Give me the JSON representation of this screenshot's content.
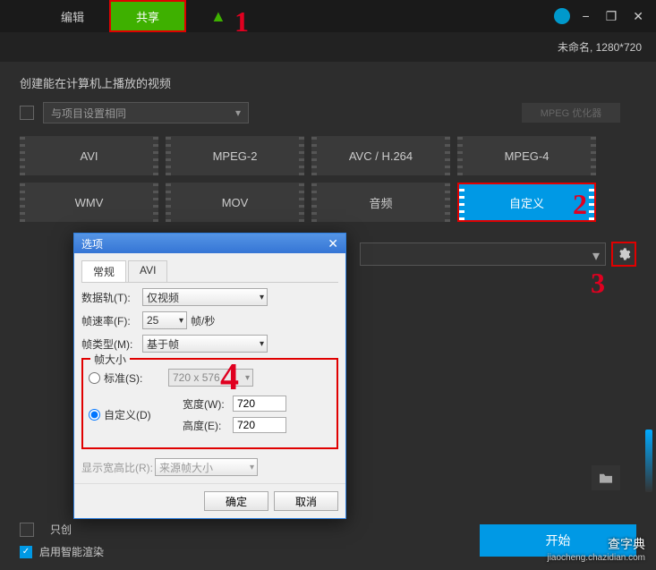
{
  "titlebar": {
    "edit_tab": "编辑",
    "share_tab": "共享"
  },
  "status": "未命名, 1280*720",
  "section_title": "创建能在计算机上播放的视频",
  "project_dropdown": {
    "label": "与项目设置相同",
    "caret": "▾"
  },
  "mpeg_btn": "MPEG 优化器",
  "formats": {
    "avi": "AVI",
    "mpeg2": "MPEG-2",
    "avc": "AVC / H.264",
    "mpeg4": "MPEG-4",
    "wmv": "WMV",
    "mov": "MOV",
    "audio": "音频",
    "custom": "自定义"
  },
  "checks": {
    "only_create": "只创",
    "smart_render": "启用智能渲染"
  },
  "start_btn": "开始",
  "dialog": {
    "title": "选项",
    "tabs": {
      "general": "常规",
      "avi": "AVI"
    },
    "data_track": {
      "label": "数据轨(T):",
      "value": "仅视频"
    },
    "frame_rate": {
      "label": "帧速率(F):",
      "value": "25",
      "unit": "帧/秒"
    },
    "frame_type": {
      "label": "帧类型(M):",
      "value": "基于帧"
    },
    "frame_size": {
      "legend": "帧大小",
      "standard": {
        "label": "标准(S):",
        "value": "720 x 576"
      },
      "custom": {
        "label": "自定义(D)",
        "width_label": "宽度(W):",
        "width": "720",
        "height_label": "高度(E):",
        "height": "720"
      }
    },
    "aspect": {
      "label": "显示宽高比(R):",
      "value": "来源帧大小"
    },
    "ok": "确定",
    "cancel": "取消"
  },
  "annotations": {
    "a1": "1",
    "a2": "2",
    "a3": "3",
    "a4": "4"
  },
  "watermark": {
    "title": "查字典",
    "sub": "jiaocheng.chazidian.com"
  },
  "checkmark": "✓",
  "close_x": "✕"
}
